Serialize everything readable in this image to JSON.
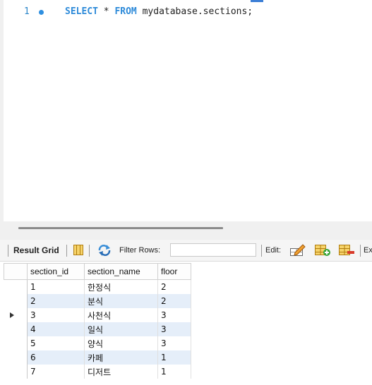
{
  "editor": {
    "line_number": "1",
    "query": {
      "kw1": "SELECT",
      "star": " * ",
      "kw2": "FROM",
      "rest": " mydatabase.sections;"
    }
  },
  "toolbar": {
    "result_grid_label": "Result Grid",
    "filter_rows_label": "Filter Rows:",
    "filter_value": "",
    "edit_label": "Edit:",
    "export_label": "Ex"
  },
  "grid": {
    "columns": [
      "section_id",
      "section_name",
      "floor"
    ],
    "selected_row": 3,
    "rows": [
      {
        "section_id": "1",
        "section_name": "한정식",
        "floor": "2"
      },
      {
        "section_id": "2",
        "section_name": "분식",
        "floor": "2"
      },
      {
        "section_id": "3",
        "section_name": "사천식",
        "floor": "3"
      },
      {
        "section_id": "4",
        "section_name": "일식",
        "floor": "3"
      },
      {
        "section_id": "5",
        "section_name": "양식",
        "floor": "3"
      },
      {
        "section_id": "6",
        "section_name": "카페",
        "floor": "1"
      },
      {
        "section_id": "7",
        "section_name": "디저트",
        "floor": "1"
      }
    ]
  },
  "colors": {
    "keyword": "#2d8ad9",
    "line_number": "#2b86c9",
    "row_stripe": "#e5eef9",
    "execution_dot": "#2e8fe0"
  }
}
